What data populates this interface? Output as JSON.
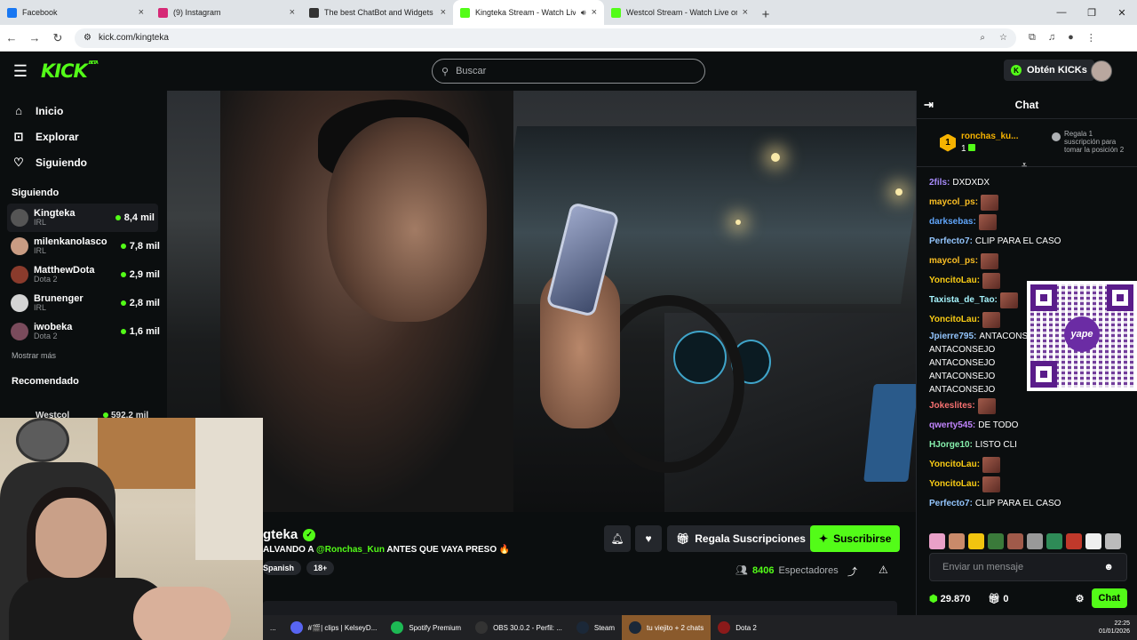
{
  "browser": {
    "tabs": [
      {
        "label": "Facebook",
        "icon": "facebook-icon",
        "color": "#1877f2",
        "active": false,
        "audio": false
      },
      {
        "label": "(9) Instagram",
        "icon": "instagram-icon",
        "color": "#d62976",
        "active": false,
        "audio": false
      },
      {
        "label": "The best ChatBot and Widgets",
        "icon": "chatbot-icon",
        "color": "#333333",
        "active": false,
        "audio": false
      },
      {
        "label": "Kingteka Stream - Watch Live",
        "icon": "kick-icon",
        "color": "#53fc18",
        "active": true,
        "audio": true
      },
      {
        "label": "Westcol Stream - Watch Live on",
        "icon": "kick-icon",
        "color": "#53fc18",
        "active": false,
        "audio": false
      }
    ],
    "url": "kick.com/kingteka"
  },
  "header": {
    "logo": "KICK",
    "beta": "BETA",
    "search_placeholder": "Buscar",
    "kicks_label": "Obtén KICKs"
  },
  "sidebar": {
    "nav": [
      {
        "label": "Inicio",
        "icon": "home-icon"
      },
      {
        "label": "Explorar",
        "icon": "compass-icon"
      },
      {
        "label": "Siguiendo",
        "icon": "heart-icon"
      }
    ],
    "following_title": "Siguiendo",
    "following": [
      {
        "name": "Kingteka",
        "game": "IRL",
        "viewers": "8,4 mil",
        "color": "#555555"
      },
      {
        "name": "milenkanolasco",
        "game": "IRL",
        "viewers": "7,8 mil",
        "color": "#c99c83"
      },
      {
        "name": "MatthewDota",
        "game": "Dota 2",
        "viewers": "2,9 mil",
        "color": "#8a3b2c"
      },
      {
        "name": "Brunenger",
        "game": "IRL",
        "viewers": "2,8 mil",
        "color": "#d4d4d4"
      },
      {
        "name": "iwobeka",
        "game": "Dota 2",
        "viewers": "1,6 mil",
        "color": "#7a4b5c"
      }
    ],
    "show_more": "Mostrar más",
    "recommended_title": "Recomendado",
    "recommended_first": {
      "name": "Westcol",
      "viewers": "592,2 mil"
    }
  },
  "stream": {
    "channel": "Kingteka",
    "channel_visible": "gteka",
    "title_prefix": "ALVANDO A ",
    "mention": "@Ronchas_Kun",
    "title_suffix": " ANTES QUE VAYA PRESO 🔥",
    "tags": [
      "Spanish",
      "18+"
    ],
    "regala_label": "Regala Suscripciones",
    "subscribe_label": "Suscribirse",
    "viewers": "8406",
    "viewers_label": "Espectadores"
  },
  "chat": {
    "title": "Chat",
    "pinned": {
      "rank": "1",
      "user": "ronchas_ku...",
      "count": "1",
      "gift_text": "Regala 1 suscripción para tomar la posición 2"
    },
    "messages": [
      {
        "user": "2fils:",
        "color": "#a78bfa",
        "text": "DXDXDX",
        "emote": false
      },
      {
        "user": "maycol_ps:",
        "color": "#fbbf24",
        "text": "",
        "emote": true
      },
      {
        "user": "darksebas:",
        "color": "#60a5fa",
        "text": "",
        "emote": true
      },
      {
        "user": "Perfecto7:",
        "color": "#93c5fd",
        "text": "CLIP PARA EL CASO",
        "emote": false
      },
      {
        "user": "maycol_ps:",
        "color": "#fbbf24",
        "text": "",
        "emote": true
      },
      {
        "user": "YoncitoLau:",
        "color": "#facc15",
        "text": "",
        "emote": true
      },
      {
        "user": "Taxista_de_Tao:",
        "color": "#a5f3fc",
        "text": "",
        "emote": true
      },
      {
        "user": "YoncitoLau:",
        "color": "#facc15",
        "text": "",
        "emote": true
      },
      {
        "user": "Jpierre795:",
        "color": "#93c5fd",
        "text": "ANTACONSEJO",
        "emote": false
      },
      {
        "user": "",
        "color": "#ffffff",
        "text": "ANTACONSEJO",
        "emote": false
      },
      {
        "user": "",
        "color": "#ffffff",
        "text": "ANTACONSEJO",
        "emote": false
      },
      {
        "user": "",
        "color": "#ffffff",
        "text": "ANTACONSEJO",
        "emote": false
      },
      {
        "user": "",
        "color": "#ffffff",
        "text": "ANTACONSEJO",
        "emote": false
      },
      {
        "user": "Jokeslites:",
        "color": "#f87171",
        "text": "",
        "emote": true
      },
      {
        "user": "qwerty545:",
        "color": "#c084fc",
        "text": "DE TODO",
        "emote": false
      },
      {
        "user": "HJorge10:",
        "color": "#86efac",
        "text": "LISTO CLI",
        "emote": false
      },
      {
        "user": "YoncitoLau:",
        "color": "#facc15",
        "text": "",
        "emote": true
      },
      {
        "user": "YoncitoLau:",
        "color": "#facc15",
        "text": "",
        "emote": true
      },
      {
        "user": "Perfecto7:",
        "color": "#93c5fd",
        "text": "CLIP PARA EL CASO",
        "emote": false
      }
    ],
    "qr_label": "yape",
    "input_placeholder": "Enviar un mensaje",
    "points": "29.870",
    "gifts": "0",
    "send_label": "Chat"
  },
  "taskbar": {
    "items": [
      {
        "label": "#🎬| clips | KelseyD...",
        "color": "#5865f2",
        "active": false
      },
      {
        "label": "Spotify Premium",
        "color": "#1db954",
        "active": false
      },
      {
        "label": "OBS 30.0.2 - Perfil: ...",
        "color": "#333333",
        "active": false
      },
      {
        "label": "Steam",
        "color": "#1b2838",
        "active": false
      },
      {
        "label": "tu viejito + 2 chats",
        "color": "#1b2838",
        "active": true
      },
      {
        "label": "Dota 2",
        "color": "#8b1a1a",
        "active": false
      }
    ],
    "time": "22:25",
    "date": "01/01/2026"
  }
}
